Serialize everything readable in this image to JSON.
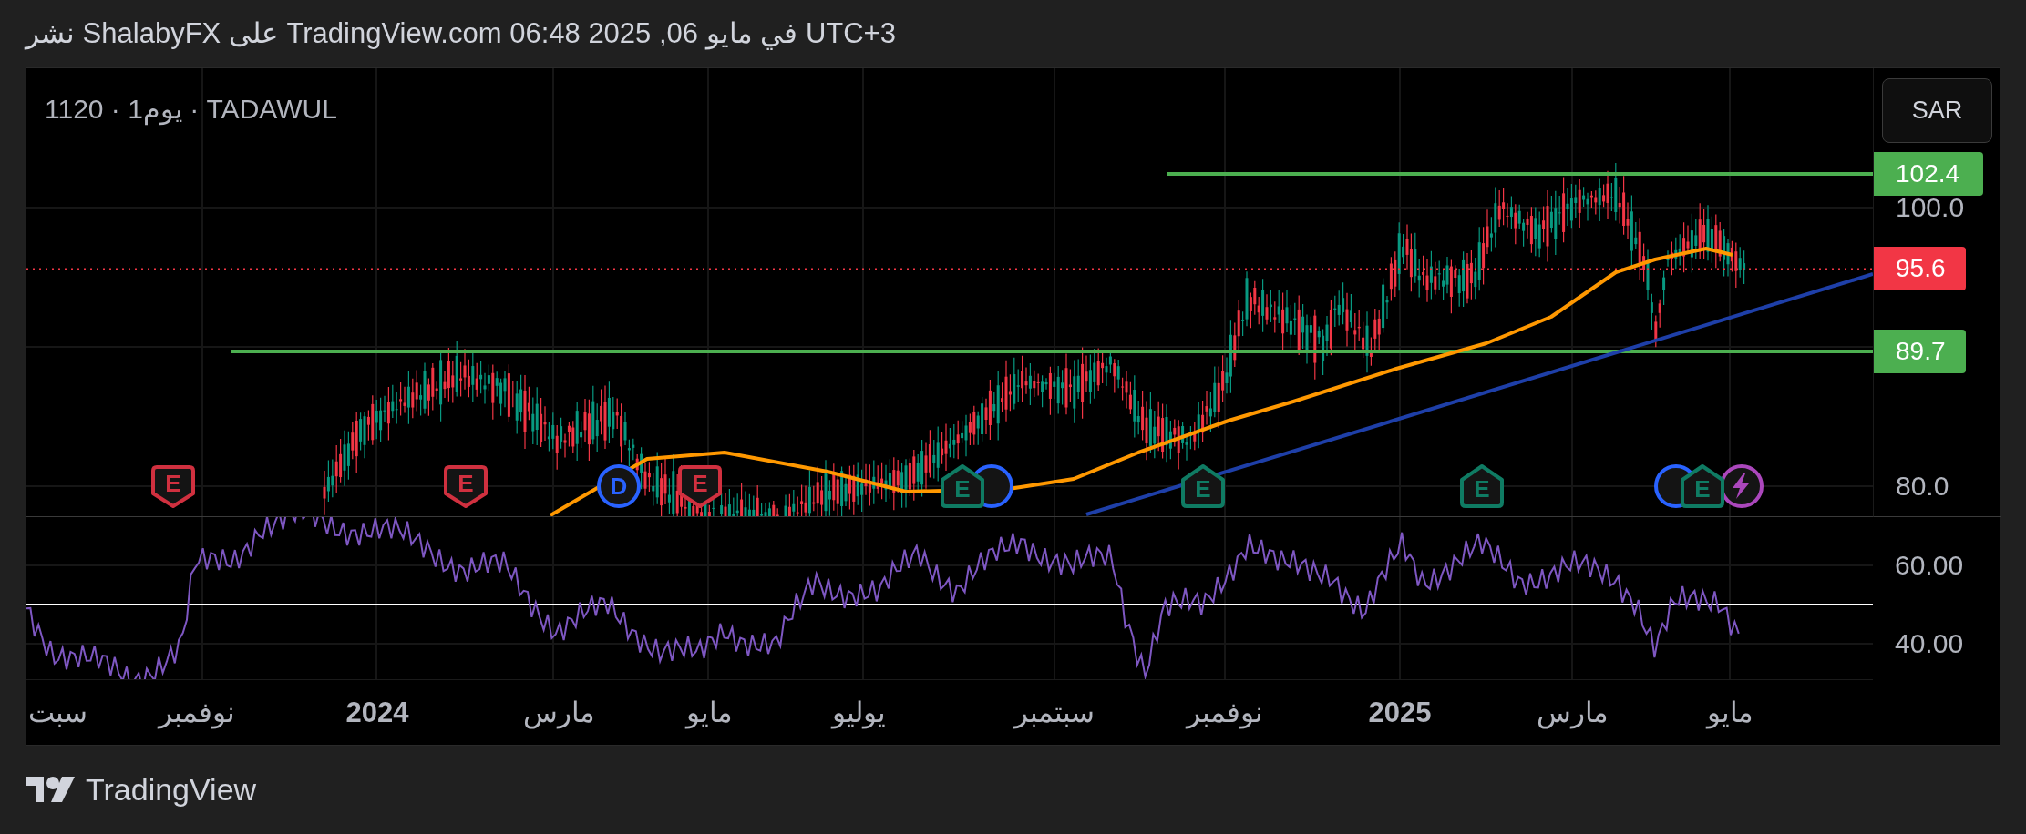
{
  "header": {
    "text": "نشر ShalabyFX على TradingView.com في مايو 06, 2025 06:48 UTC+3"
  },
  "chart": {
    "legend": "1120 · 1يوم · TADAWUL",
    "currency_button": "SAR",
    "price_axis": {
      "ticks": [
        "100.0",
        "80.0"
      ],
      "labels": [
        {
          "text": "102.4",
          "color": "#4caf50"
        },
        {
          "text": "95.6",
          "color": "#f23645"
        },
        {
          "text": "89.7",
          "color": "#4caf50"
        }
      ]
    },
    "events": [
      {
        "kind": "bolt",
        "color": "#ab47bc"
      },
      {
        "kind": "house",
        "label": "E",
        "color": "#0f7b63"
      },
      {
        "kind": "circle",
        "color": "#2962ff"
      },
      {
        "kind": "house",
        "label": "E",
        "color": "#0f7b63"
      },
      {
        "kind": "house",
        "label": "E",
        "color": "#0f7b63"
      },
      {
        "kind": "circle",
        "color": "#2962ff"
      },
      {
        "kind": "house",
        "label": "E",
        "color": "#0f7b63"
      },
      {
        "kind": "shield",
        "label": "E",
        "color": "#d0303f"
      },
      {
        "kind": "circle",
        "label": "D",
        "color": "#2962ff"
      },
      {
        "kind": "shield",
        "label": "E",
        "color": "#d0303f"
      },
      {
        "kind": "shield",
        "label": "E",
        "color": "#d0303f"
      }
    ],
    "rsi_axis": {
      "ticks": [
        "60.00",
        "40.00"
      ]
    },
    "time_axis": [
      {
        "label": "مايو",
        "kind": "month"
      },
      {
        "label": "مارس",
        "kind": "month"
      },
      {
        "label": "2025",
        "kind": "year"
      },
      {
        "label": "نوفمبر",
        "kind": "month"
      },
      {
        "label": "سبتمبر",
        "kind": "month"
      },
      {
        "label": "يوليو",
        "kind": "month"
      },
      {
        "label": "مايو",
        "kind": "month"
      },
      {
        "label": "مارس",
        "kind": "month"
      },
      {
        "label": "2024",
        "kind": "year"
      },
      {
        "label": "نوفمبر",
        "kind": "month"
      },
      {
        "label": "سبت",
        "kind": "month"
      }
    ]
  },
  "footer": {
    "brand": "TradingView"
  }
}
